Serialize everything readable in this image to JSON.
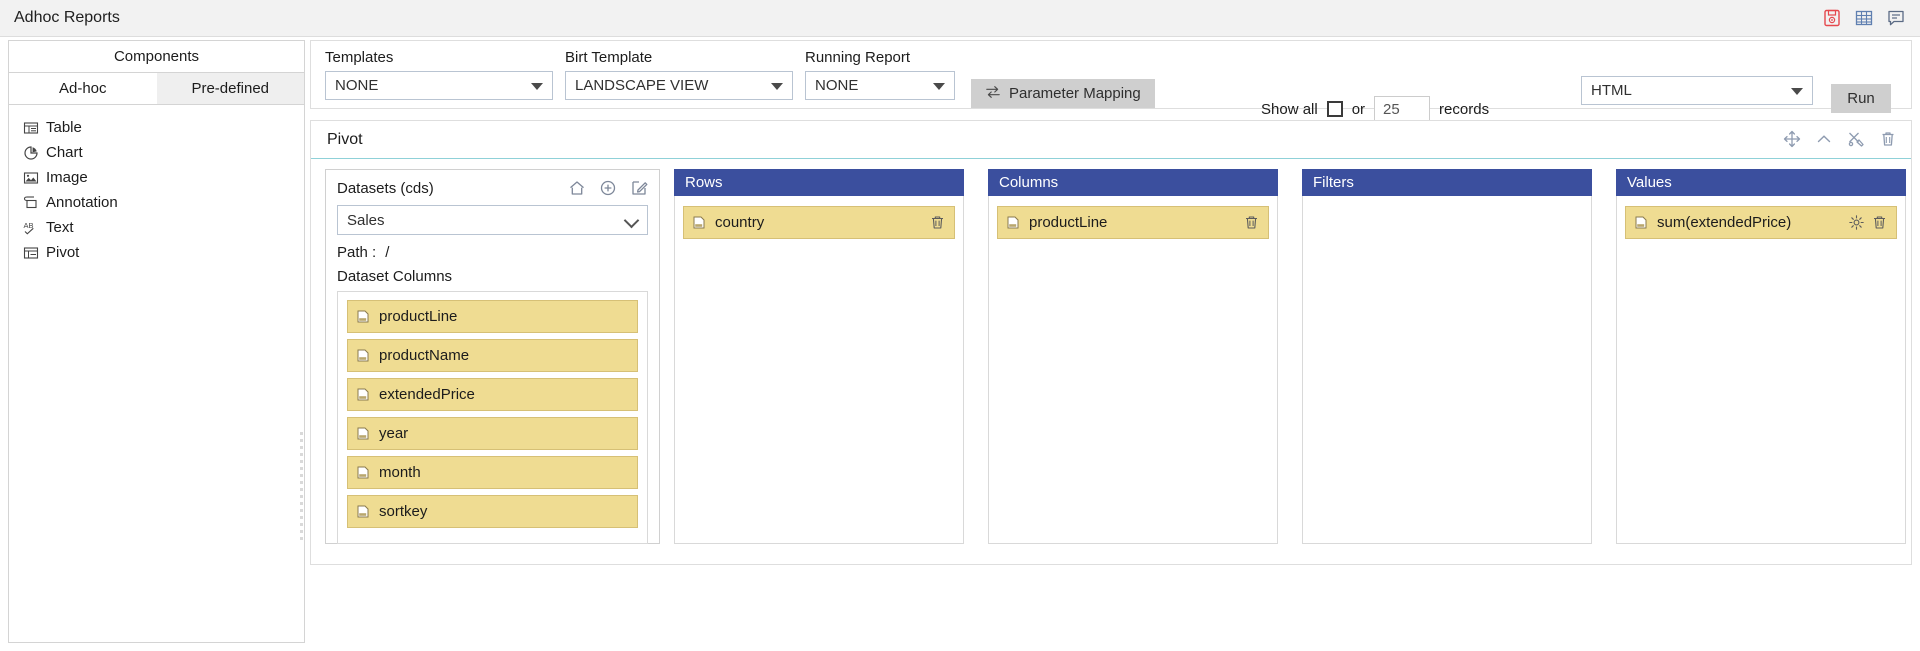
{
  "app": {
    "title": "Adhoc Reports",
    "header_icons": [
      {
        "name": "save-pdf-icon"
      },
      {
        "name": "table-grid-icon"
      },
      {
        "name": "comment-icon"
      }
    ]
  },
  "sidebar": {
    "header": "Components",
    "tabs": [
      {
        "label": "Ad-hoc",
        "active": true
      },
      {
        "label": "Pre-defined",
        "active": false
      }
    ],
    "items": [
      {
        "label": "Table",
        "icon": "table-icon"
      },
      {
        "label": "Chart",
        "icon": "pie-chart-icon"
      },
      {
        "label": "Image",
        "icon": "image-icon"
      },
      {
        "label": "Annotation",
        "icon": "annotation-icon"
      },
      {
        "label": "Text",
        "icon": "text-ab-icon"
      },
      {
        "label": "Pivot",
        "icon": "pivot-icon"
      }
    ]
  },
  "toolbar": {
    "templates": {
      "label": "Templates",
      "value": "NONE"
    },
    "birt_template": {
      "label": "Birt Template",
      "value": "LANDSCAPE VIEW"
    },
    "running_report": {
      "label": "Running Report",
      "value": "NONE"
    },
    "parameter_mapping_label": "Parameter Mapping",
    "show_all_label": "Show all",
    "or_label": "or",
    "records_value": "25",
    "records_label": "records",
    "format": {
      "value": "HTML"
    },
    "run_label": "Run"
  },
  "pivot": {
    "title": "Pivot",
    "tools": [
      {
        "name": "move-icon"
      },
      {
        "name": "collapse-chevron-up-icon"
      },
      {
        "name": "settings-tools-icon"
      },
      {
        "name": "delete-trash-icon"
      }
    ],
    "datasets": {
      "title": "Datasets (cds)",
      "icons": [
        {
          "name": "home-icon"
        },
        {
          "name": "add-circle-icon"
        },
        {
          "name": "edit-icon"
        }
      ],
      "selected": "Sales",
      "path_label": "Path :",
      "path_value": "/",
      "columns_label": "Dataset Columns",
      "columns": [
        "productLine",
        "productName",
        "extendedPrice",
        "year",
        "month",
        "sortkey"
      ]
    },
    "zones": [
      {
        "title": "Rows",
        "chips": [
          {
            "label": "country",
            "gear": false
          }
        ]
      },
      {
        "title": "Columns",
        "chips": [
          {
            "label": "productLine",
            "gear": false
          }
        ]
      },
      {
        "title": "Filters",
        "chips": []
      },
      {
        "title": "Values",
        "chips": [
          {
            "label": "sum(extendedPrice)",
            "gear": true
          }
        ]
      }
    ]
  },
  "colors": {
    "zone_header": "#3b4f9e",
    "chip_bg": "#efdc92",
    "chip_border": "#d6c076",
    "accent_rule": "#8fd1d8",
    "button_bg": "#cfcfcf"
  }
}
